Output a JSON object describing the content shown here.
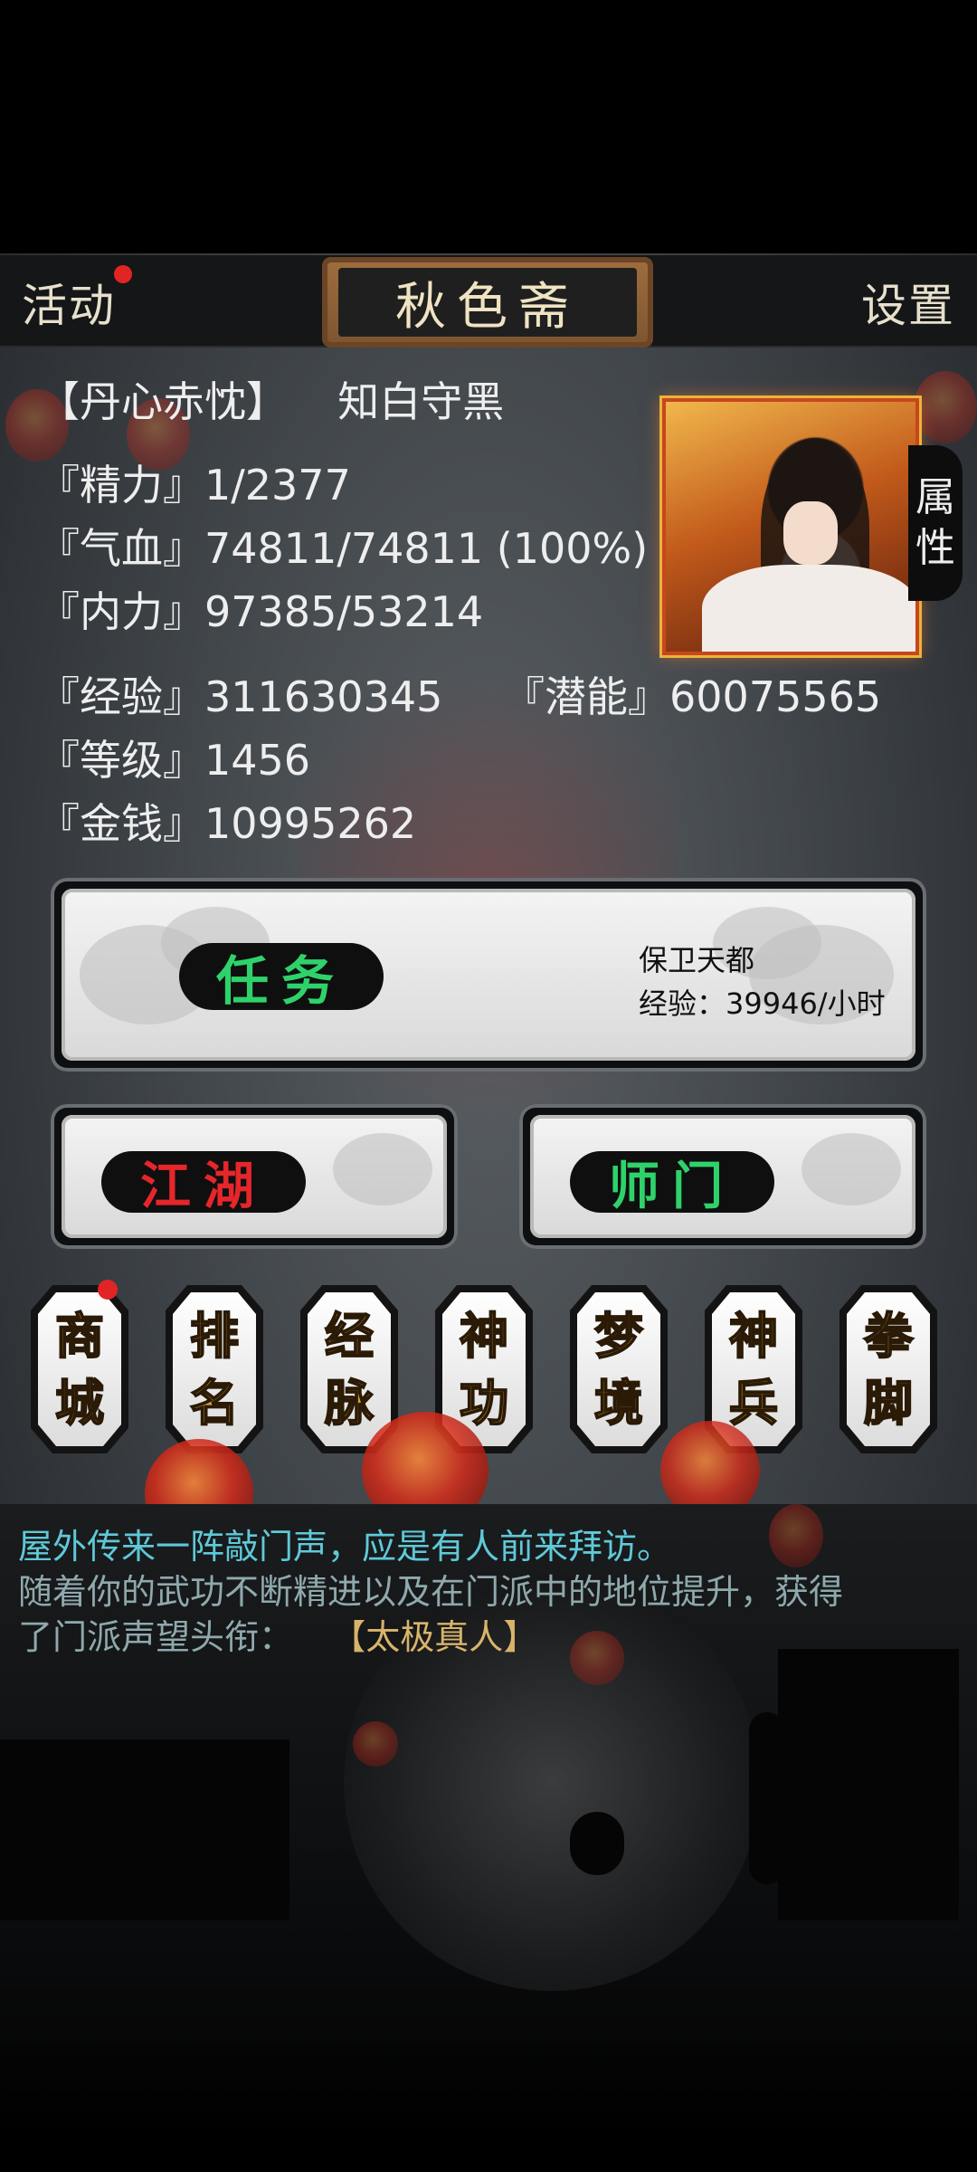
{
  "header": {
    "left_button": "活动",
    "title": "秋色斋",
    "right_button": "设置"
  },
  "character": {
    "title_tag": "【丹心赤忱】",
    "name": "知白守黑",
    "stats": {
      "jingli": "『精力』1/2377",
      "qixue": "『气血』74811/74811 (100%)",
      "neili": "『内力』97385/53214",
      "jingyan": "『经验』311630345",
      "qianneng": "『潜能』60075565",
      "dengji": "『等级』1456",
      "jinqian": "『金钱』10995262"
    },
    "side_tab": [
      "属",
      "性"
    ]
  },
  "task_card": {
    "button": "任务",
    "task_name": "保卫天都",
    "task_rate": "经验：39946/小时"
  },
  "mid_buttons": {
    "jianghu": "江湖",
    "shimen": "师门"
  },
  "menu_tiles": [
    {
      "top": "商",
      "bottom": "城"
    },
    {
      "top": "排",
      "bottom": "名"
    },
    {
      "top": "经",
      "bottom": "脉"
    },
    {
      "top": "神",
      "bottom": "功"
    },
    {
      "top": "梦",
      "bottom": "境"
    },
    {
      "top": "神",
      "bottom": "兵"
    },
    {
      "top": "拳",
      "bottom": "脚"
    }
  ],
  "log": {
    "line1": "屋外传来一阵敲门声，应是有人前来拜访。",
    "line2": "随着你的武功不断精进以及在门派中的地位提升，获得",
    "line3_prefix": "了门派声望头衔：",
    "line3_title": "【太极真人】"
  },
  "colors": {
    "log_cyan": "#5fc9d8",
    "log_gold": "#d8b46a",
    "green_text": "#2fd26a",
    "red_text": "#e5262a",
    "notify_dot": "#e32424"
  }
}
